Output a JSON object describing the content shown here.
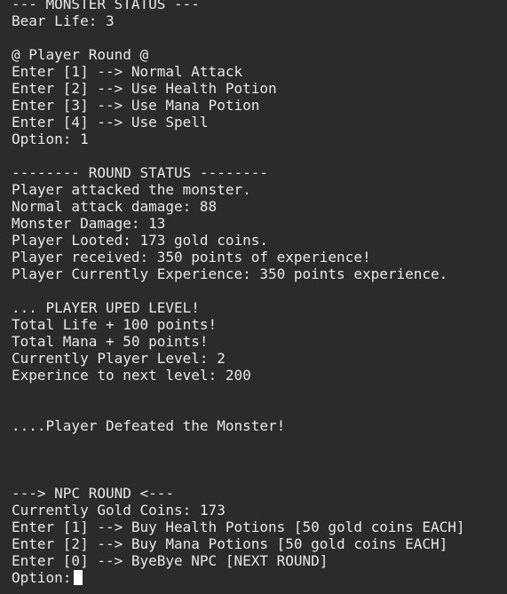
{
  "terminal": {
    "lines": [
      "--- MONSTER STATUS ---",
      "Bear Life: 3",
      "",
      "@ Player Round @",
      "Enter [1] --> Normal Attack",
      "Enter [2] --> Use Health Potion",
      "Enter [3] --> Use Mana Potion",
      "Enter [4] --> Use Spell",
      "Option: 1",
      "",
      "-------- ROUND STATUS --------",
      "Player attacked the monster.",
      "Normal attack damage: 88",
      "Monster Damage: 13",
      "Player Looted: 173 gold coins.",
      "Player received: 350 points of experience!",
      "Player Currently Experience: 350 points experience.",
      "",
      "... PLAYER UPED LEVEL!",
      "Total Life + 100 points!",
      "Total Mana + 50 points!",
      "Currently Player Level: 2",
      "Experince to next level: 200",
      "",
      "",
      "....Player Defeated the Monster!",
      "",
      "",
      "",
      "---> NPC ROUND <---",
      "Currently Gold Coins: 173",
      "Enter [1] --> Buy Health Potions [50 gold coins EACH]",
      "Enter [2] --> Buy Mana Potions [50 gold coins EACH]",
      "Enter [0] --> ByeBye NPC [NEXT ROUND]"
    ],
    "prompt": "Option:"
  },
  "colors": {
    "background": "#2b2b2b",
    "text": "#e8e8e8",
    "cursor": "#ffffff"
  }
}
